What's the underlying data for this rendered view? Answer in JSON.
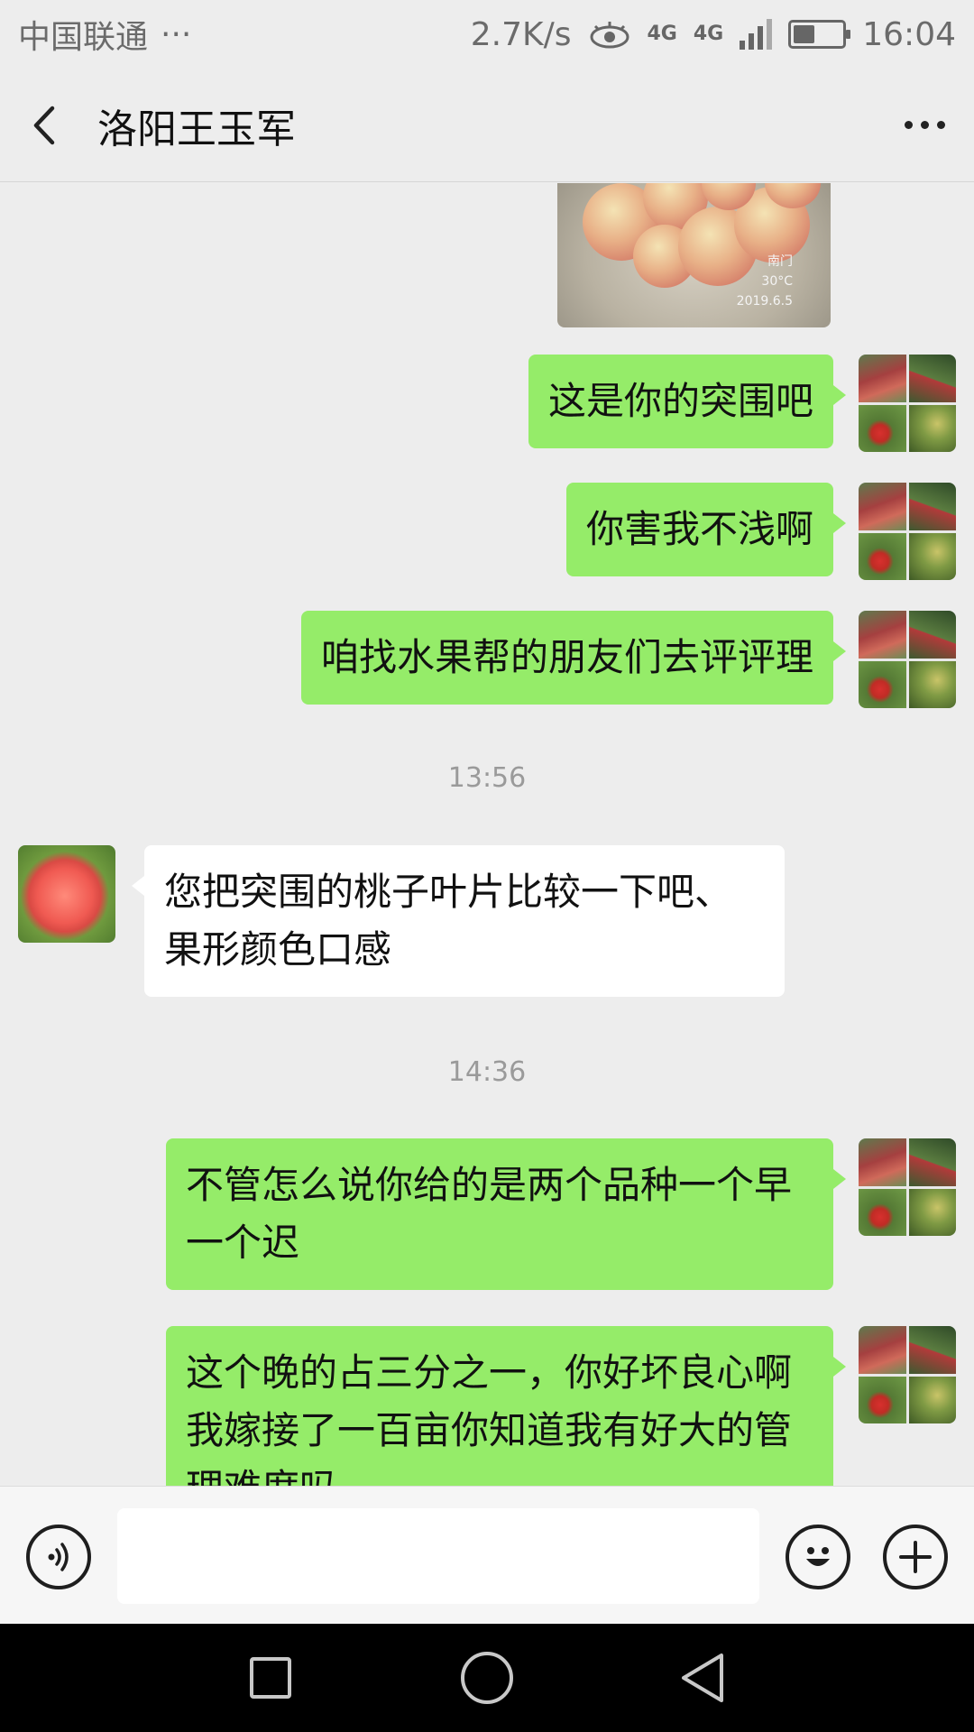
{
  "status_bar": {
    "carrier": "中国联通",
    "more": "···",
    "net_speed": "2.7K/s",
    "network_type": "4G",
    "network_type_2": "4G",
    "time": "16:04",
    "battery_level": 0.45,
    "icons": [
      "eye-icon",
      "signal-icon",
      "battery-icon"
    ]
  },
  "header": {
    "title": "洛阳王玉军",
    "back_icon": "chevron-left-icon",
    "more_icon": "more-dots-icon"
  },
  "messages": [
    {
      "type": "image",
      "from": "me",
      "caption_place": "南门",
      "caption_temp": "30°C",
      "caption_date": "2019.6.5"
    },
    {
      "type": "text",
      "from": "me",
      "text": "这是你的突围吧"
    },
    {
      "type": "text",
      "from": "me",
      "text": "你害我不浅啊"
    },
    {
      "type": "text",
      "from": "me",
      "text": "咱找水果帮的朋友们去评评理"
    },
    {
      "type": "time",
      "text": "13:56"
    },
    {
      "type": "text",
      "from": "other",
      "text": "您把突围的桃子叶片比较一下吧、果形颜色口感"
    },
    {
      "type": "time",
      "text": "14:36"
    },
    {
      "type": "text",
      "from": "me",
      "text": "不管怎么说你给的是两个品种一个早一个迟"
    },
    {
      "type": "text",
      "from": "me",
      "text": "这个晚的占三分之一，你好坏良心啊我嫁接了一百亩你知道我有好大的管理难度吗"
    }
  ],
  "input_bar": {
    "voice_icon": "voice-icon",
    "input_value": "",
    "emoji_icon": "emoji-icon",
    "plus_icon": "plus-icon"
  },
  "nav_bar": {
    "icons": [
      "recent-apps-icon",
      "home-icon",
      "back-triangle-icon"
    ]
  }
}
